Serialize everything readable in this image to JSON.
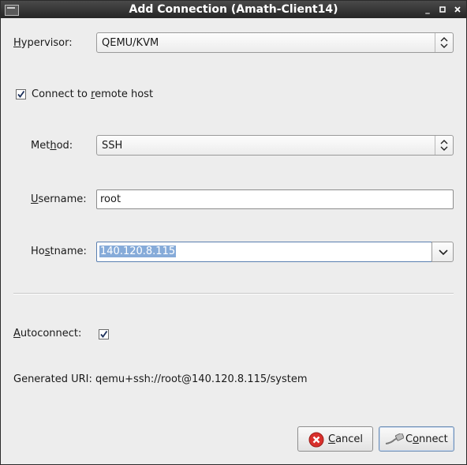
{
  "window": {
    "title": "Add Connection (Amath-Client14)",
    "controls": {
      "minimize": "_",
      "maximize": "▫",
      "close": "×"
    }
  },
  "form": {
    "hypervisor": {
      "label_prefix": "",
      "label_mnemonic": "H",
      "label_rest": "ypervisor:",
      "value": "QEMU/KVM"
    },
    "remote": {
      "label_prefix": "Connect to ",
      "label_mnemonic": "r",
      "label_rest": "emote host",
      "checked": true
    },
    "method": {
      "label_prefix": "Met",
      "label_mnemonic": "h",
      "label_rest": "od:",
      "value": "SSH"
    },
    "username": {
      "label_prefix": "",
      "label_mnemonic": "U",
      "label_rest": "sername:",
      "value": "root"
    },
    "hostname": {
      "label_prefix": "Ho",
      "label_mnemonic": "s",
      "label_rest": "tname:",
      "value": "140.120.8.115"
    },
    "autoconnect": {
      "label_prefix": "",
      "label_mnemonic": "A",
      "label_rest": "utoconnect:",
      "checked": true
    },
    "generated_uri": {
      "label": "Generated URI:",
      "value": "qemu+ssh://root@140.120.8.115/system"
    }
  },
  "buttons": {
    "cancel": {
      "mnemonic": "C",
      "rest": "ancel",
      "icon": "cancel-icon"
    },
    "connect": {
      "prefix": "C",
      "mnemonic": "o",
      "rest": "nnect",
      "icon": "connect-plug-icon"
    }
  },
  "colors": {
    "selection": "#86abd9",
    "titlebar": "#333333",
    "cancel_icon": "#d9302c"
  }
}
